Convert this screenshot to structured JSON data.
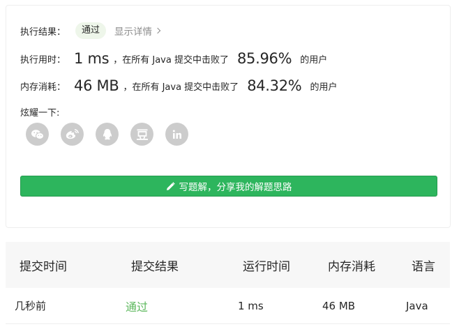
{
  "result": {
    "label": "执行结果：",
    "status": "通过",
    "details_link": "显示详情"
  },
  "runtime": {
    "label": "执行用时：",
    "value": "1 ms",
    "middle_text": "，在所有 Java 提交中击败了",
    "percent": "85.96%",
    "tail_text": "的用户"
  },
  "memory": {
    "label": "内存消耗：",
    "value": "46 MB",
    "middle_text": "，在所有 Java 提交中击败了",
    "percent": "84.32%",
    "tail_text": "的用户"
  },
  "share": {
    "label": "炫耀一下:",
    "icons": [
      "wechat-icon",
      "weibo-icon",
      "qq-icon",
      "douban-icon",
      "linkedin-icon"
    ],
    "icon_color": "#cccccc"
  },
  "solution_button": {
    "label": "写题解，分享我的解题思路",
    "color": "#2db55d"
  },
  "submissions": {
    "headers": [
      "提交时间",
      "提交结果",
      "运行时间",
      "内存消耗",
      "语言"
    ],
    "rows": [
      {
        "time": "几秒前",
        "result": "通过",
        "runtime": "1 ms",
        "memory": "46 MB",
        "language": "Java"
      }
    ],
    "accepted_color": "#5cb85c"
  }
}
